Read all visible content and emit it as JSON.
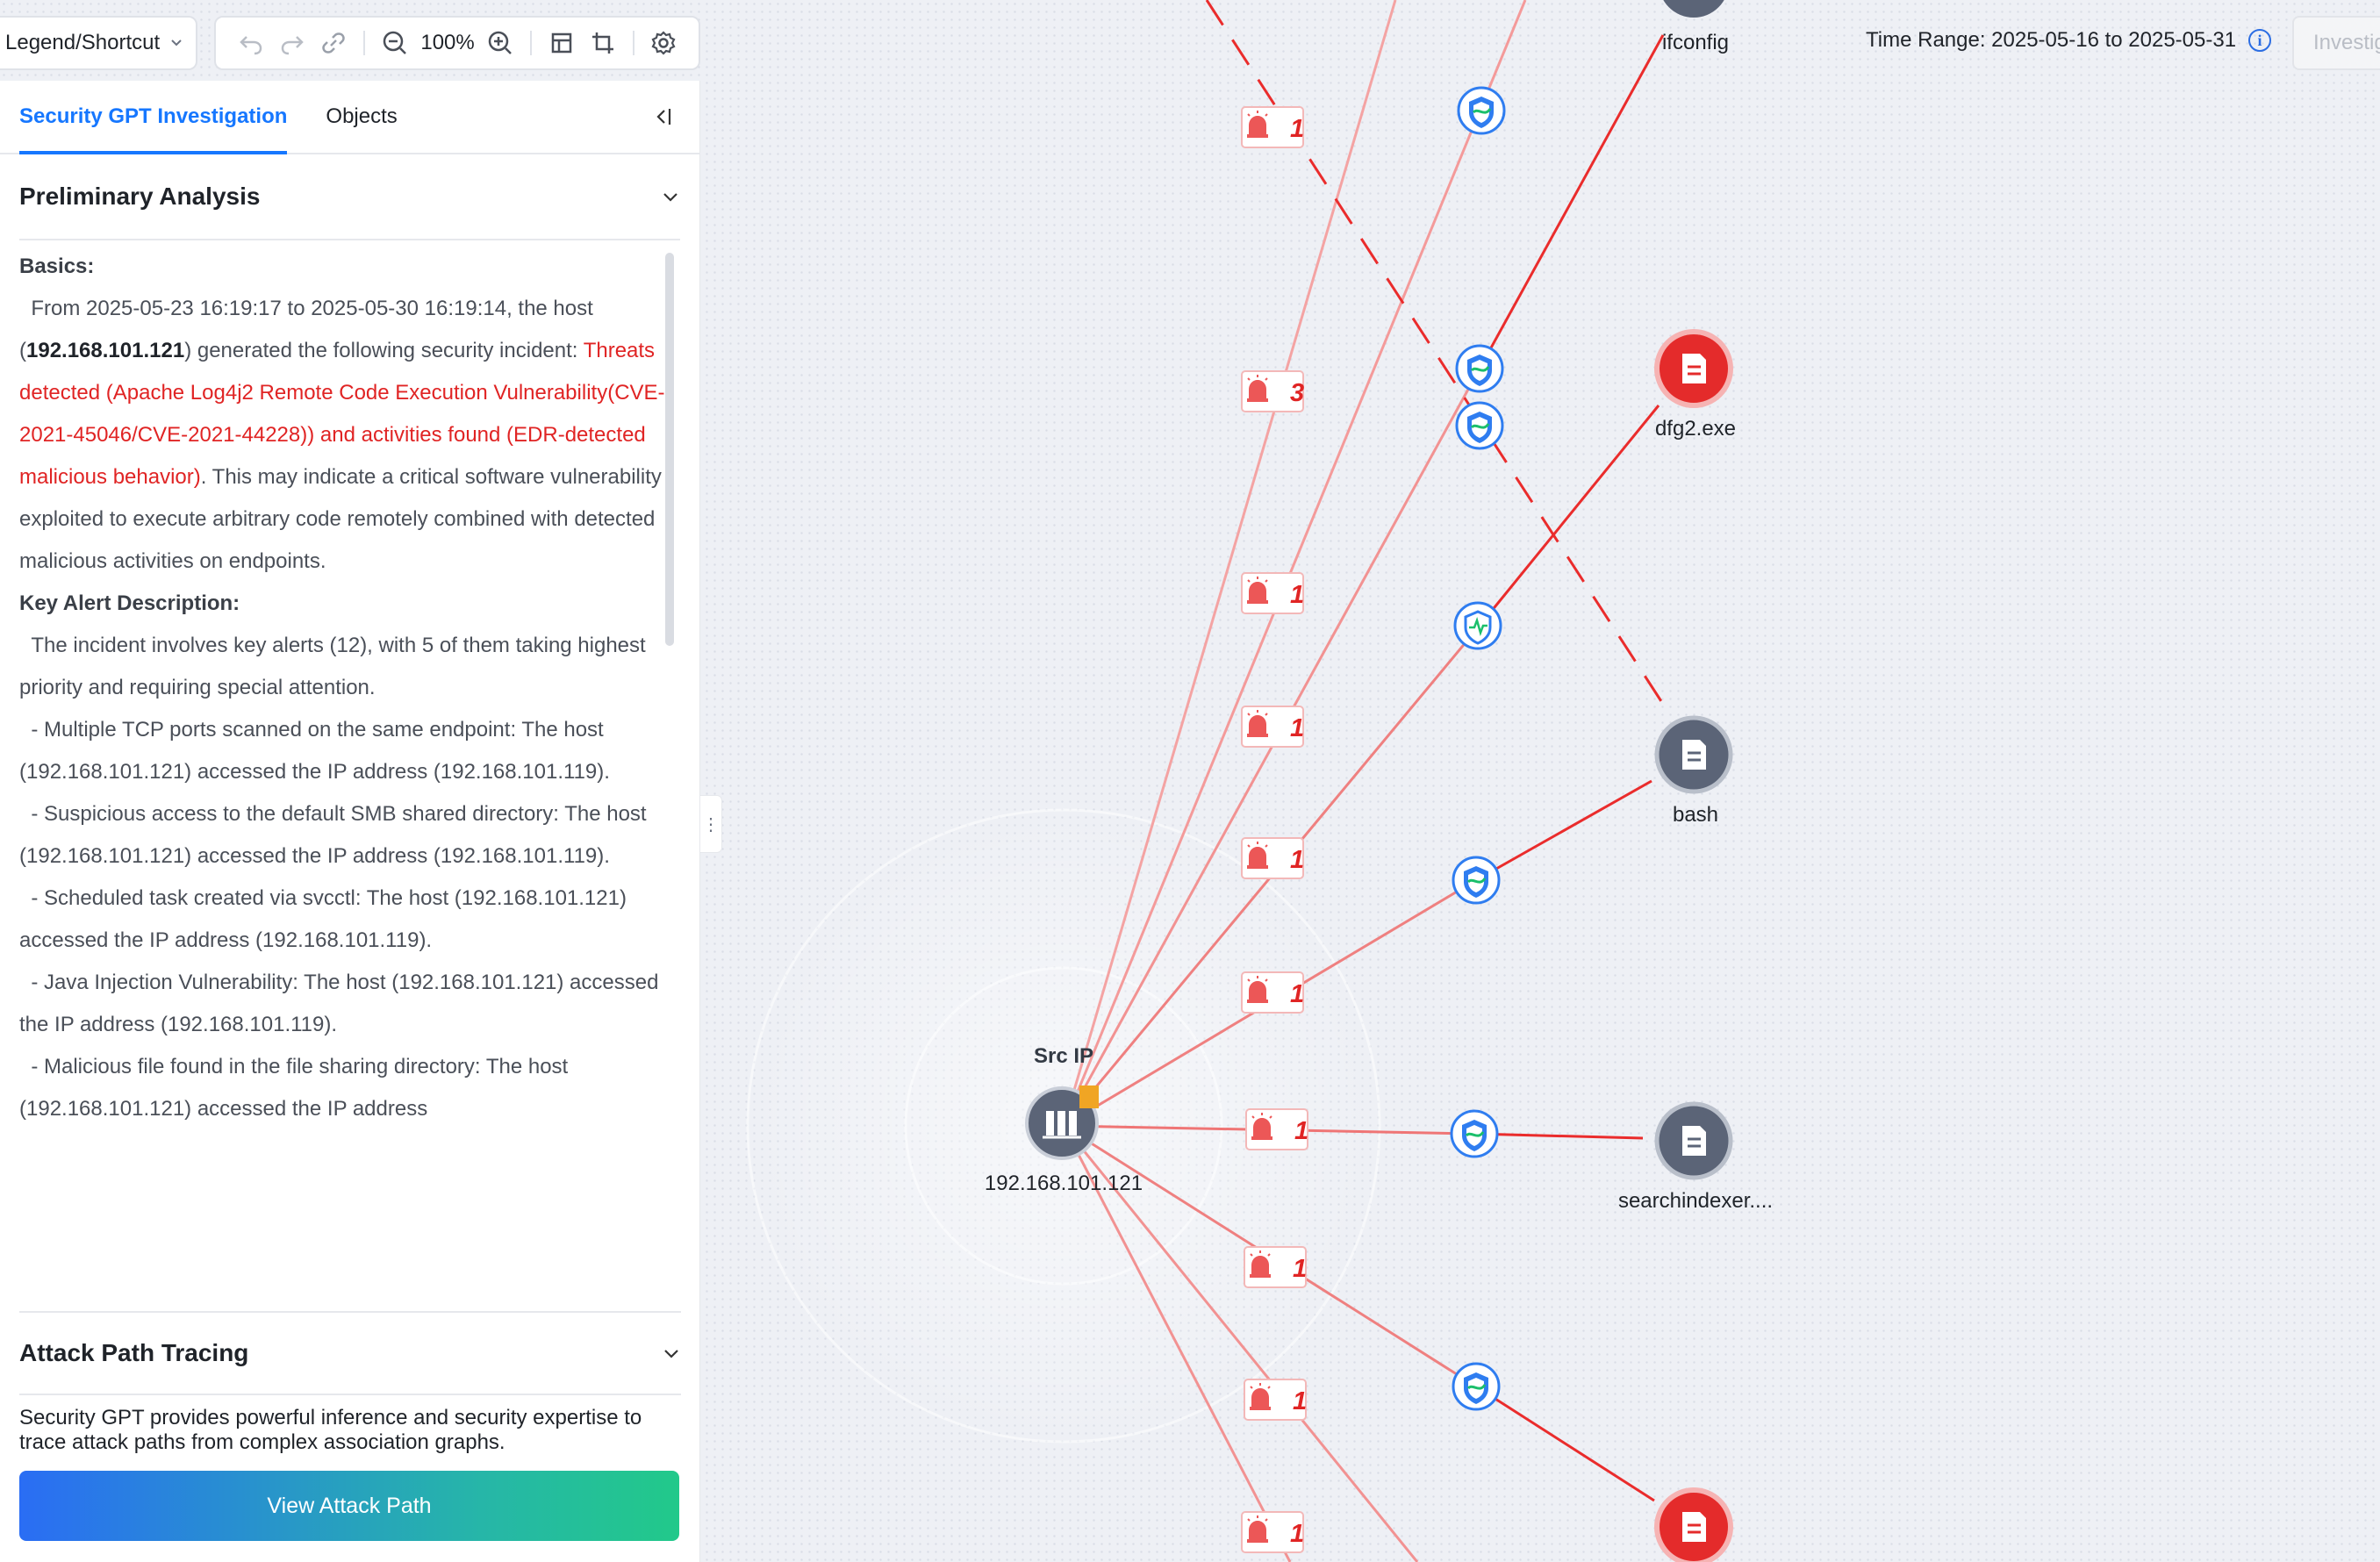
{
  "toolbar": {
    "legend_label": "Legend/Shortcut",
    "zoom_level": "100%",
    "icons": [
      "undo-icon",
      "redo-icon",
      "link-icon",
      "zoom-out-icon",
      "zoom-in-icon",
      "fit-view-icon",
      "crop-icon",
      "settings-icon"
    ]
  },
  "header": {
    "time_range": "Time Range: 2025-05-16 to 2025-05-31",
    "investigate_label": "Investig"
  },
  "panel": {
    "tabs": [
      {
        "label": "Security GPT Investigation",
        "active": true
      },
      {
        "label": "Objects",
        "active": false
      }
    ],
    "preliminary": {
      "title": "Preliminary Analysis",
      "basics_label": "Basics:",
      "basics_pre": "From 2025-05-23 16:19:17 to 2025-05-30 16:19:14, the host (",
      "basics_ip": "192.168.101.121",
      "basics_mid": ") generated the following security incident: ",
      "basics_red": "Threats detected (Apache Log4j2 Remote Code Execution Vulnerability(CVE-2021-45046/CVE-2021-44228)) and activities found (EDR-detected malicious behavior)",
      "basics_post": ". This may indicate a critical software vulnerability exploited to execute arbitrary code remotely combined with detected malicious activities on endpoints.",
      "key_label": "Key Alert Description:",
      "key_intro": "The incident involves key alerts (12), with 5 of them taking highest priority and requiring special attention.",
      "alerts": [
        "- Multiple TCP ports scanned on the same endpoint: The host (192.168.101.121) accessed the IP address (192.168.101.119).",
        "- Suspicious access to the default SMB shared directory: The host (192.168.101.121) accessed the IP address (192.168.101.119).",
        "- Scheduled task created via svcctl: The host (192.168.101.121) accessed the IP address (192.168.101.119).",
        "- Java Injection Vulnerability: The host (192.168.101.121) accessed the IP address (192.168.101.119).",
        "- Malicious file found in the file sharing directory: The host (192.168.101.121) accessed the IP address"
      ]
    },
    "attack": {
      "title": "Attack Path Tracing",
      "description": "Security GPT provides powerful inference and security expertise to trace attack paths from complex association graphs.",
      "button": "View Attack Path"
    }
  },
  "graph": {
    "src_title": "Src IP",
    "src_ip": "192.168.101.121",
    "nodes": [
      {
        "label": "ifconfig",
        "status": "neutral"
      },
      {
        "label": "dfg2.exe",
        "status": "malicious"
      },
      {
        "label": "bash",
        "status": "neutral"
      },
      {
        "label": "searchindexer....",
        "status": "neutral"
      },
      {
        "label": "",
        "status": "malicious"
      }
    ],
    "alert_badges": [
      "1",
      "3",
      "1",
      "1",
      "1",
      "1",
      "1",
      "1",
      "1",
      "1"
    ],
    "colors": {
      "edge_strong": "#ea2c2c",
      "edge_light": "#f4a3a3",
      "malicious": "#e42b2b",
      "neutral": "#5b6477",
      "accent": "#1677ff"
    }
  }
}
